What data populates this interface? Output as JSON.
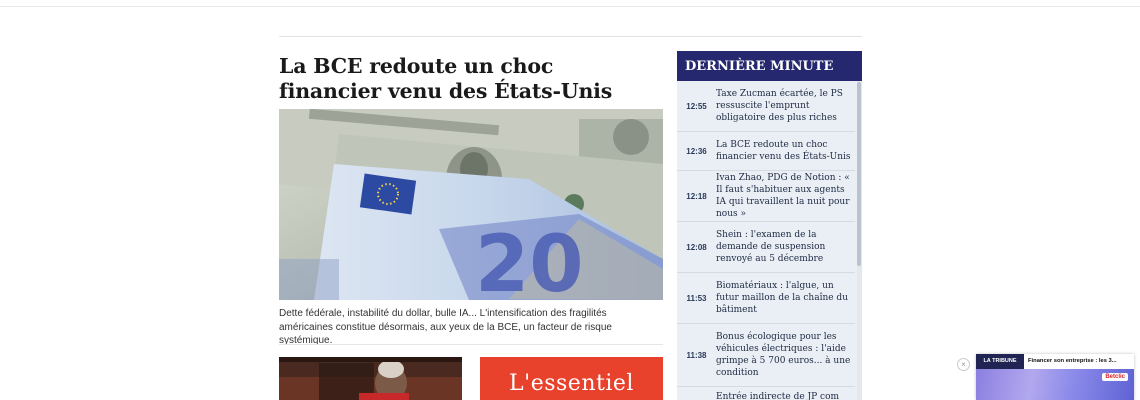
{
  "article": {
    "headline": "La BCE redoute un choc financier venu des États-Unis",
    "caption": "Dette fédérale, instabilité du dollar, bulle IA... L'intensification des fragilités américaines constitue désormais, aux yeux de la BCE, un facteur de risque systémique."
  },
  "related": {
    "card2_title": "L'essentiel"
  },
  "breaking": {
    "header": "DERNIÈRE MINUTE",
    "items": [
      {
        "time": "12:55",
        "title": "Taxe Zucman écartée, le PS ressuscite l'emprunt obligatoire des plus riches"
      },
      {
        "time": "12:36",
        "title": "La BCE redoute un choc financier venu des États-Unis"
      },
      {
        "time": "12:18",
        "title": "Ivan Zhao, PDG de Notion : « Il faut s'habituer aux agents IA qui travaillent la nuit pour nous »"
      },
      {
        "time": "12:08",
        "title": "Shein : l'examen de la demande de suspension renvoyé au 5 décembre"
      },
      {
        "time": "11:53",
        "title": "Biomatériaux : l'algue, un futur maillon de la chaîne du bâtiment"
      },
      {
        "time": "11:38",
        "title": "Bonus écologique pour les véhicules électriques : l'aide grimpe à 5 700 euros... à une condition"
      },
      {
        "time": "",
        "title": "Entrée indirecte de JP com au..."
      }
    ]
  },
  "promo": {
    "brand": "LA TRIBUNE",
    "text": "Financer son entreprise : les 3...",
    "logo": "Betclic"
  },
  "colors": {
    "breaking_header": "#25286e",
    "breaking_bg": "#e9eff4",
    "essentiel_red": "#e8412c"
  }
}
